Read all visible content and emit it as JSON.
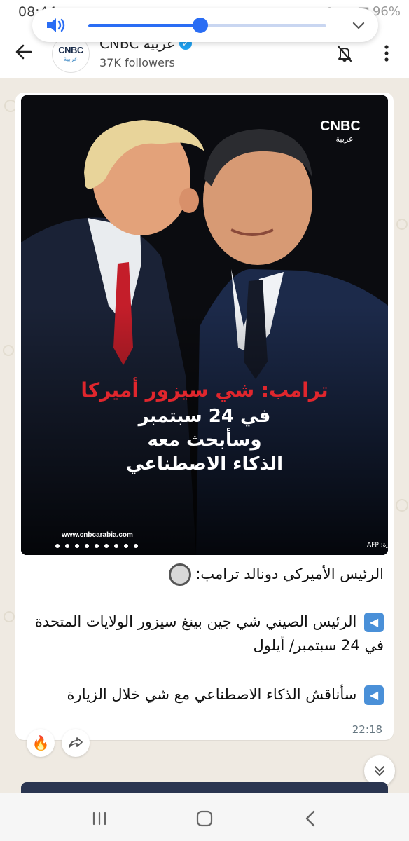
{
  "status_bar": {
    "time": "08:44",
    "battery": "96%"
  },
  "volume_panel": {
    "level_fraction": 0.47
  },
  "header": {
    "avatar_text_top": "CNBC",
    "avatar_text_bottom": "عربية",
    "channel_name": "CNBC عربية",
    "followers": "37K followers"
  },
  "post": {
    "image": {
      "logo_top": "CNBC",
      "logo_bottom": "عربية",
      "headline_red": "ترامب: شي سيزور أميركا",
      "headline_line2": "في 24 سبتمبر",
      "headline_line3": "وسأبحث معه",
      "headline_line4": "الذكاء الاصطناعي",
      "website": "www.cnbcarabia.com",
      "credit": "مصدر الصورة: AFP"
    },
    "line1": "الرئيس الأميركي دونالد ترامب:",
    "line2": "الرئيس الصيني شي جين بينغ سيزور الولايات المتحدة في 24 سبتمبر/ أيلول",
    "line3": "سأناقش الذكاء الاصطناعي مع شي خلال الزيارة",
    "time": "22:18",
    "reaction_emoji": "🔥"
  },
  "colors": {
    "accent_blue": "#2a6df4",
    "headline_red": "#e0262d",
    "chat_background": "#efeae2"
  }
}
